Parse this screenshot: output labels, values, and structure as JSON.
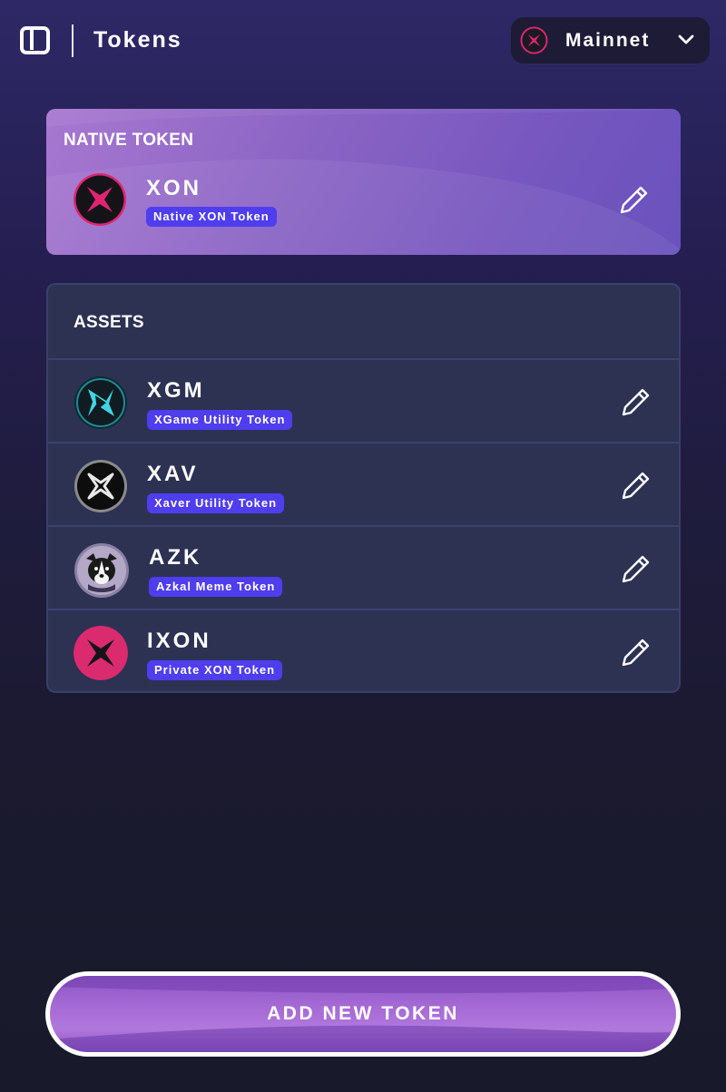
{
  "header": {
    "title": "Tokens",
    "network": {
      "label": "Mainnet",
      "icon": "xon-network-icon"
    }
  },
  "native": {
    "section_title": "NATIVE TOKEN",
    "token": {
      "symbol": "XON",
      "name": "Native XON Token",
      "icon": "xon-logo"
    }
  },
  "assets": {
    "section_title": "ASSETS",
    "items": [
      {
        "symbol": "XGM",
        "name": "XGame Utility Token",
        "icon": "xgm-logo"
      },
      {
        "symbol": "XAV",
        "name": "Xaver Utility Token",
        "icon": "xav-logo"
      },
      {
        "symbol": "AZK",
        "name": "Azkal Meme Token",
        "icon": "azk-logo"
      },
      {
        "symbol": "IXON",
        "name": "Private XON Token",
        "icon": "ixon-logo"
      }
    ]
  },
  "actions": {
    "add_token_label": "ADD NEW TOKEN"
  },
  "colors": {
    "badge": "#4f3df0",
    "accent_pink": "#e0256f",
    "card_bg": "#2d3253",
    "network_bg": "#1d1b35"
  }
}
